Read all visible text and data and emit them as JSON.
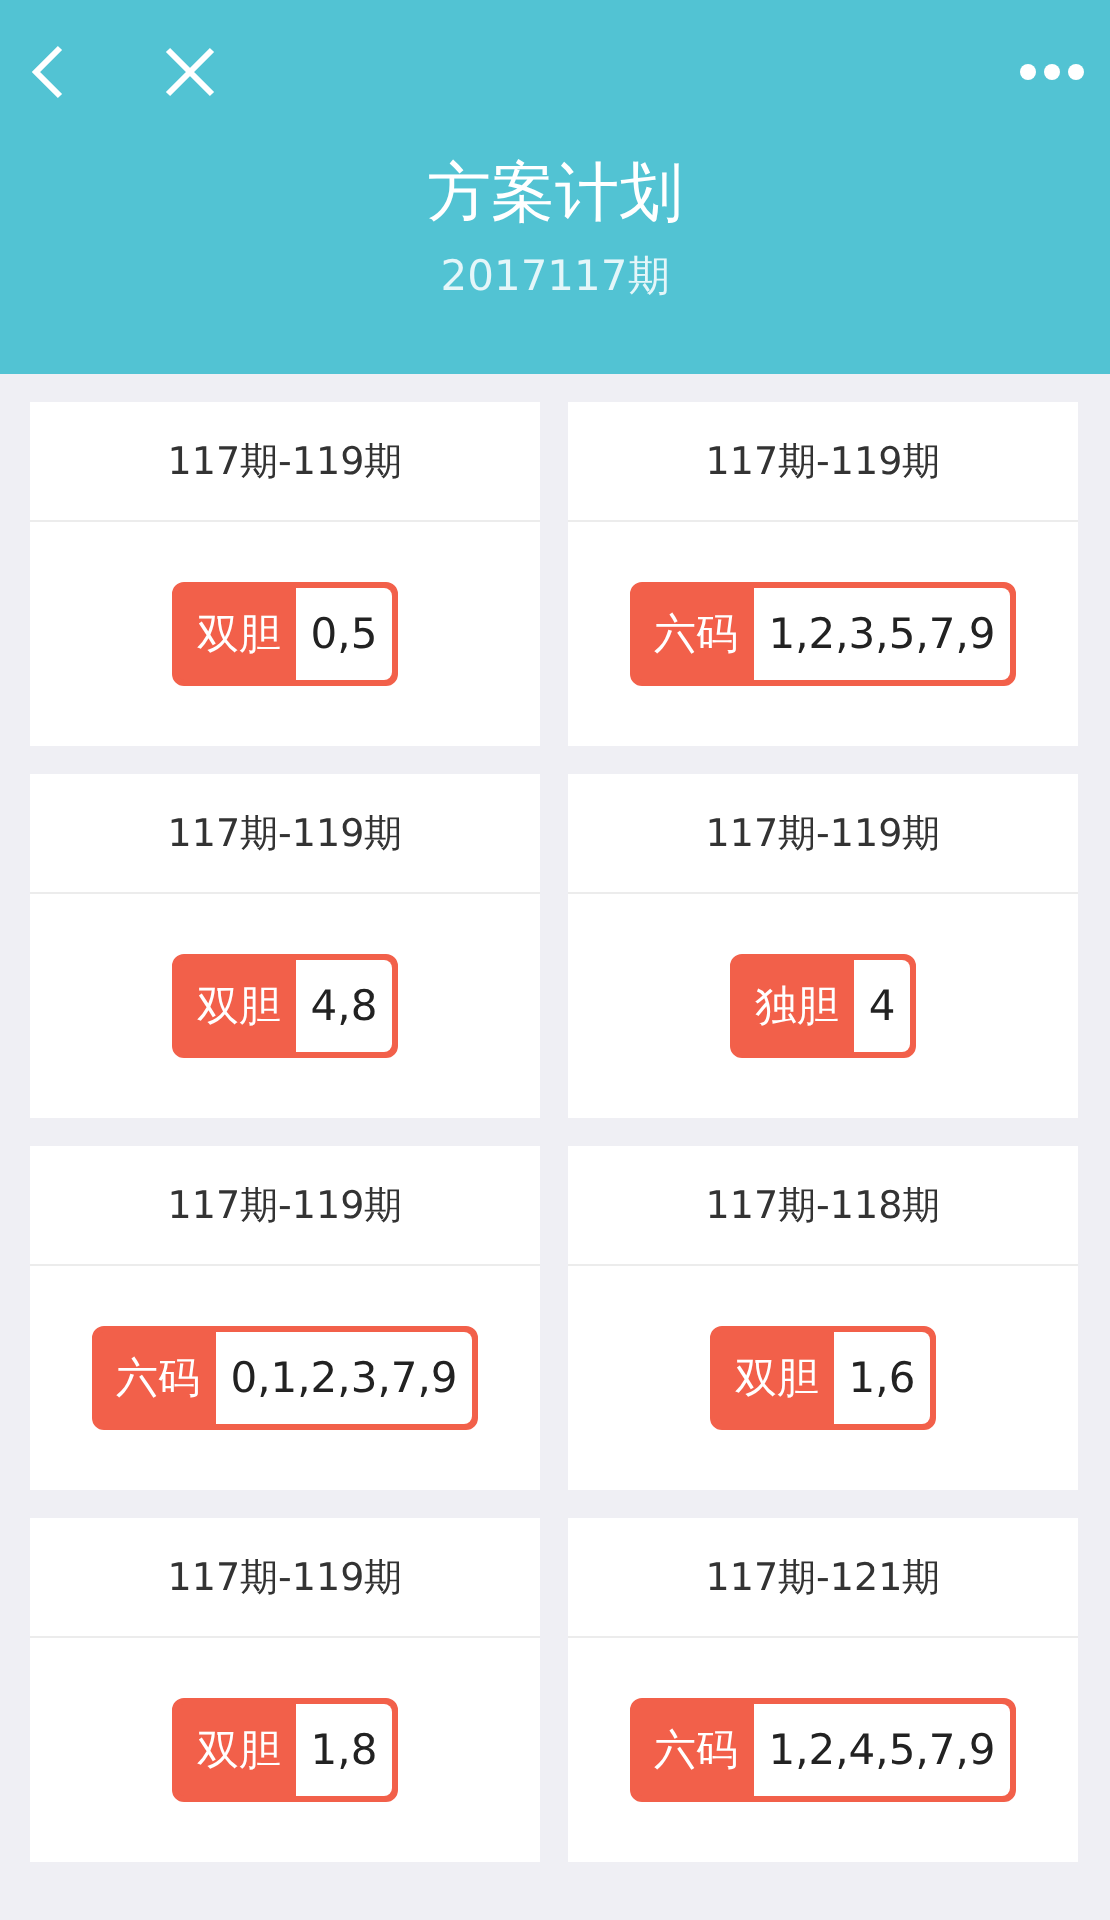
{
  "header": {
    "title": "方案计划",
    "subtitle": "2017117期"
  },
  "plans": [
    {
      "range": "117期-119期",
      "type": "双胆",
      "numbers": "0,5"
    },
    {
      "range": "117期-119期",
      "type": "六码",
      "numbers": "1,2,3,5,7,9"
    },
    {
      "range": "117期-119期",
      "type": "双胆",
      "numbers": "4,8"
    },
    {
      "range": "117期-119期",
      "type": "独胆",
      "numbers": "4"
    },
    {
      "range": "117期-119期",
      "type": "六码",
      "numbers": "0,1,2,3,7,9"
    },
    {
      "range": "117期-118期",
      "type": "双胆",
      "numbers": "1,6"
    },
    {
      "range": "117期-119期",
      "type": "双胆",
      "numbers": "1,8"
    },
    {
      "range": "117期-121期",
      "type": "六码",
      "numbers": "1,2,4,5,7,9"
    }
  ]
}
